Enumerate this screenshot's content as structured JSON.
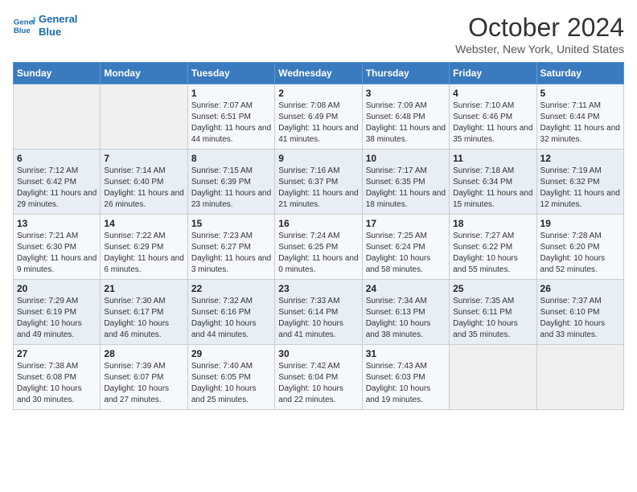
{
  "header": {
    "logo_line1": "General",
    "logo_line2": "Blue",
    "month": "October 2024",
    "location": "Webster, New York, United States"
  },
  "days_of_week": [
    "Sunday",
    "Monday",
    "Tuesday",
    "Wednesday",
    "Thursday",
    "Friday",
    "Saturday"
  ],
  "weeks": [
    [
      {
        "num": "",
        "info": ""
      },
      {
        "num": "",
        "info": ""
      },
      {
        "num": "1",
        "info": "Sunrise: 7:07 AM\nSunset: 6:51 PM\nDaylight: 11 hours and 44 minutes."
      },
      {
        "num": "2",
        "info": "Sunrise: 7:08 AM\nSunset: 6:49 PM\nDaylight: 11 hours and 41 minutes."
      },
      {
        "num": "3",
        "info": "Sunrise: 7:09 AM\nSunset: 6:48 PM\nDaylight: 11 hours and 38 minutes."
      },
      {
        "num": "4",
        "info": "Sunrise: 7:10 AM\nSunset: 6:46 PM\nDaylight: 11 hours and 35 minutes."
      },
      {
        "num": "5",
        "info": "Sunrise: 7:11 AM\nSunset: 6:44 PM\nDaylight: 11 hours and 32 minutes."
      }
    ],
    [
      {
        "num": "6",
        "info": "Sunrise: 7:12 AM\nSunset: 6:42 PM\nDaylight: 11 hours and 29 minutes."
      },
      {
        "num": "7",
        "info": "Sunrise: 7:14 AM\nSunset: 6:40 PM\nDaylight: 11 hours and 26 minutes."
      },
      {
        "num": "8",
        "info": "Sunrise: 7:15 AM\nSunset: 6:39 PM\nDaylight: 11 hours and 23 minutes."
      },
      {
        "num": "9",
        "info": "Sunrise: 7:16 AM\nSunset: 6:37 PM\nDaylight: 11 hours and 21 minutes."
      },
      {
        "num": "10",
        "info": "Sunrise: 7:17 AM\nSunset: 6:35 PM\nDaylight: 11 hours and 18 minutes."
      },
      {
        "num": "11",
        "info": "Sunrise: 7:18 AM\nSunset: 6:34 PM\nDaylight: 11 hours and 15 minutes."
      },
      {
        "num": "12",
        "info": "Sunrise: 7:19 AM\nSunset: 6:32 PM\nDaylight: 11 hours and 12 minutes."
      }
    ],
    [
      {
        "num": "13",
        "info": "Sunrise: 7:21 AM\nSunset: 6:30 PM\nDaylight: 11 hours and 9 minutes."
      },
      {
        "num": "14",
        "info": "Sunrise: 7:22 AM\nSunset: 6:29 PM\nDaylight: 11 hours and 6 minutes."
      },
      {
        "num": "15",
        "info": "Sunrise: 7:23 AM\nSunset: 6:27 PM\nDaylight: 11 hours and 3 minutes."
      },
      {
        "num": "16",
        "info": "Sunrise: 7:24 AM\nSunset: 6:25 PM\nDaylight: 11 hours and 0 minutes."
      },
      {
        "num": "17",
        "info": "Sunrise: 7:25 AM\nSunset: 6:24 PM\nDaylight: 10 hours and 58 minutes."
      },
      {
        "num": "18",
        "info": "Sunrise: 7:27 AM\nSunset: 6:22 PM\nDaylight: 10 hours and 55 minutes."
      },
      {
        "num": "19",
        "info": "Sunrise: 7:28 AM\nSunset: 6:20 PM\nDaylight: 10 hours and 52 minutes."
      }
    ],
    [
      {
        "num": "20",
        "info": "Sunrise: 7:29 AM\nSunset: 6:19 PM\nDaylight: 10 hours and 49 minutes."
      },
      {
        "num": "21",
        "info": "Sunrise: 7:30 AM\nSunset: 6:17 PM\nDaylight: 10 hours and 46 minutes."
      },
      {
        "num": "22",
        "info": "Sunrise: 7:32 AM\nSunset: 6:16 PM\nDaylight: 10 hours and 44 minutes."
      },
      {
        "num": "23",
        "info": "Sunrise: 7:33 AM\nSunset: 6:14 PM\nDaylight: 10 hours and 41 minutes."
      },
      {
        "num": "24",
        "info": "Sunrise: 7:34 AM\nSunset: 6:13 PM\nDaylight: 10 hours and 38 minutes."
      },
      {
        "num": "25",
        "info": "Sunrise: 7:35 AM\nSunset: 6:11 PM\nDaylight: 10 hours and 35 minutes."
      },
      {
        "num": "26",
        "info": "Sunrise: 7:37 AM\nSunset: 6:10 PM\nDaylight: 10 hours and 33 minutes."
      }
    ],
    [
      {
        "num": "27",
        "info": "Sunrise: 7:38 AM\nSunset: 6:08 PM\nDaylight: 10 hours and 30 minutes."
      },
      {
        "num": "28",
        "info": "Sunrise: 7:39 AM\nSunset: 6:07 PM\nDaylight: 10 hours and 27 minutes."
      },
      {
        "num": "29",
        "info": "Sunrise: 7:40 AM\nSunset: 6:05 PM\nDaylight: 10 hours and 25 minutes."
      },
      {
        "num": "30",
        "info": "Sunrise: 7:42 AM\nSunset: 6:04 PM\nDaylight: 10 hours and 22 minutes."
      },
      {
        "num": "31",
        "info": "Sunrise: 7:43 AM\nSunset: 6:03 PM\nDaylight: 10 hours and 19 minutes."
      },
      {
        "num": "",
        "info": ""
      },
      {
        "num": "",
        "info": ""
      }
    ]
  ]
}
